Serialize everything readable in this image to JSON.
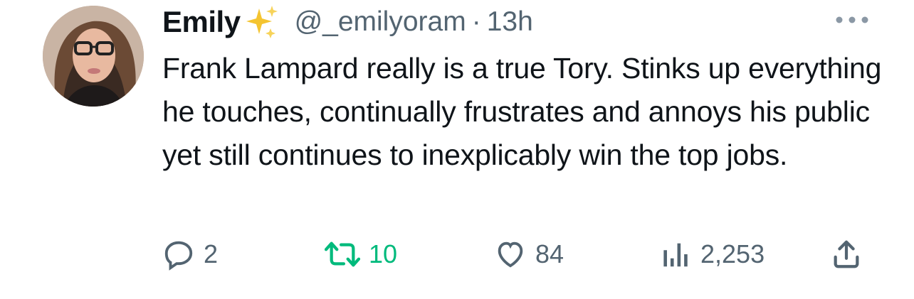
{
  "author": {
    "display_name": "Emily",
    "name_emoji": "sparkles-emoji",
    "handle": "@_emilyoram",
    "separator": "·",
    "timestamp": "13h"
  },
  "tweet": {
    "text": "Frank Lampard really is a true Tory. Stinks up everything he touches, continually frustrates and annoys his public yet still continues to inexplicably win the top jobs."
  },
  "actions": {
    "reply_count": "2",
    "retweet_count": "10",
    "like_count": "84",
    "views_count": "2,253"
  },
  "icons": {
    "more": "more-horizontal-icon",
    "reply": "reply-bubble-icon",
    "retweet": "retweet-icon",
    "like": "heart-icon",
    "views": "analytics-bars-icon",
    "share": "share-upload-icon"
  },
  "colors": {
    "text_primary": "#0f1419",
    "text_secondary": "#536471",
    "retweet_active": "#00ba7c",
    "sparkles": "#f4c430"
  }
}
